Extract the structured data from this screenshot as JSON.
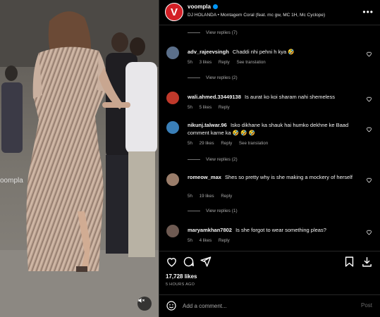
{
  "media": {
    "watermark": "oompla",
    "mute_icon": "speaker-muted-icon"
  },
  "header": {
    "avatar_letter": "V",
    "username": "voompla",
    "audio": "DJ HOLANDA • Montagem Coral (feat. mc gw, MC 1H, Mc Cyclope)",
    "more": "•••"
  },
  "comments": [
    {
      "type": "replies",
      "label": "View replies (7)"
    },
    {
      "type": "comment",
      "user": "adv_rajeevsingh",
      "text": "Chaddi nhi pehni h kya 🤣",
      "time": "5h",
      "likes": "3 likes",
      "reply": "Reply",
      "translation": "See translation",
      "avatar_color": "#5b6f8a"
    },
    {
      "type": "replies",
      "label": "View replies (2)"
    },
    {
      "type": "comment",
      "user": "wali.ahmed.33449138",
      "text": "Is aurat ko koi sharam nahi shemeless",
      "time": "5h",
      "likes": "5 likes",
      "reply": "Reply",
      "translation": "",
      "avatar_color": "#c0392b"
    },
    {
      "type": "comment",
      "user": "nikunj.talwar.96",
      "text": "Isko dikhane ka shauk hai humko dekhne ke Baad comment karne ka 🤣 🤣 🤣",
      "time": "5h",
      "likes": "29 likes",
      "reply": "Reply",
      "translation": "See translation",
      "avatar_color": "#3a7fb8"
    },
    {
      "type": "replies",
      "label": "View replies (2)"
    },
    {
      "type": "comment",
      "user": "romeow_max",
      "text": "Shes so pretty why is she making a mockery of herself",
      "time": "5h",
      "likes": "19 likes",
      "reply": "Reply",
      "translation": "",
      "avatar_color": "#9a7d6a"
    },
    {
      "type": "replies",
      "label": "View replies (1)"
    },
    {
      "type": "comment",
      "user": "maryamkhan7802",
      "text": "Is she forgot to wear something pleas?",
      "time": "5h",
      "likes": "4 likes",
      "reply": "Reply",
      "translation": "",
      "avatar_color": "#6e5a52"
    }
  ],
  "actions": {
    "like_icon": "heart-icon",
    "comment_icon": "comment-icon",
    "share_icon": "share-icon",
    "save_icon": "bookmark-icon",
    "download_icon": "download-icon"
  },
  "likes": "17,728 likes",
  "time_ago": "5 HOURS AGO",
  "add_comment": {
    "placeholder": "Add a comment...",
    "post_label": "Post"
  }
}
